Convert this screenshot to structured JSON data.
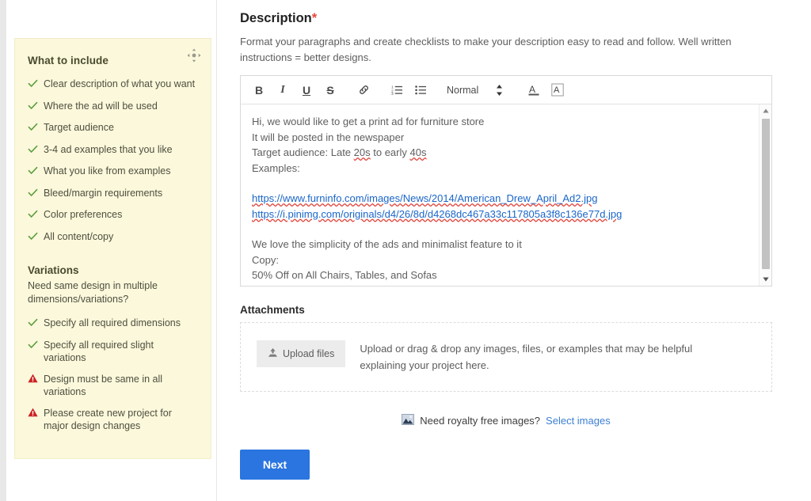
{
  "sidebar": {
    "drag_handle_icon": "move-handle-icon",
    "include_title": "What to include",
    "include_items": [
      {
        "icon": "check-icon",
        "type": "check",
        "label": "Clear description of what you want"
      },
      {
        "icon": "check-icon",
        "type": "check",
        "label": "Where the ad will be used"
      },
      {
        "icon": "check-icon",
        "type": "check",
        "label": "Target audience"
      },
      {
        "icon": "check-icon",
        "type": "check",
        "label": "3-4 ad examples that you like"
      },
      {
        "icon": "check-icon",
        "type": "check",
        "label": "What you like from examples"
      },
      {
        "icon": "check-icon",
        "type": "check",
        "label": "Bleed/margin requirements"
      },
      {
        "icon": "check-icon",
        "type": "check",
        "label": "Color preferences"
      },
      {
        "icon": "check-icon",
        "type": "check",
        "label": "All content/copy"
      }
    ],
    "variations_title": "Variations",
    "variations_question": "Need same design in multiple dimensions/variations?",
    "variations_items": [
      {
        "icon": "check-icon",
        "type": "check",
        "label": "Specify all required dimensions"
      },
      {
        "icon": "check-icon",
        "type": "check",
        "label": "Specify all required slight variations"
      },
      {
        "icon": "warning-icon",
        "type": "warn",
        "label": "Design must be same in all variations"
      },
      {
        "icon": "warning-icon",
        "type": "warn",
        "label": "Please create new project for major design changes"
      }
    ]
  },
  "main": {
    "description_heading": "Description",
    "description_required_mark": "*",
    "description_help": "Format your paragraphs and create checklists to make your description easy to read and follow. Well written instructions = better designs.",
    "toolbar": {
      "bold": "B",
      "italic": "I",
      "underline": "U",
      "strikethrough": "S",
      "link_icon": "link-icon",
      "ordered_list_icon": "ordered-list-icon",
      "bullet_list_icon": "bullet-list-icon",
      "format_select_value": "Normal",
      "spinner_icon": "up-down-arrows-icon",
      "text_color_icon": "text-color-icon",
      "highlight_color_icon": "highlight-color-icon"
    },
    "editor_content": {
      "line1": "Hi, we would like to get a print ad for furniture store",
      "line2": "It will be posted in the newspaper",
      "line3_prefix": "Target audience: Late ",
      "line3_spell1": "20s",
      "line3_mid": " to early ",
      "line3_spell2": "40s",
      "line4": "Examples:",
      "link1": "https://www.furninfo.com/images/News/2014/American_Drew_April_Ad2.jpg",
      "link2": "https://i.pinimg.com/originals/d4/26/8d/d4268dc467a33c117805a3f8c136e77d.jpg",
      "line5": "We love the simplicity of the ads and minimalist feature to it",
      "line6": "Copy:",
      "line7": "50% Off on All Chairs, Tables, and Sofas"
    },
    "scrollbar": {
      "up_arrow_icon": "scroll-up-arrow-icon",
      "down_arrow_icon": "scroll-down-arrow-icon",
      "thumb": "scrollbar-thumb"
    },
    "attachments_title": "Attachments",
    "upload_button_label": "Upload files",
    "upload_button_icon": "upload-icon",
    "attachments_help": "Upload or drag & drop any images, files, or examples that may be helpful explaining your project here.",
    "royalty_icon": "image-icon",
    "royalty_text": "Need royalty free images?",
    "royalty_link": "Select images",
    "next_button_label": "Next"
  },
  "colors": {
    "sidebar_bg": "#fbf8dc",
    "check_green": "#5a9e3c",
    "warning_red": "#cc2222",
    "link_blue": "#1a66c9",
    "primary_blue": "#2a75e0",
    "required_red": "#e8483c"
  }
}
